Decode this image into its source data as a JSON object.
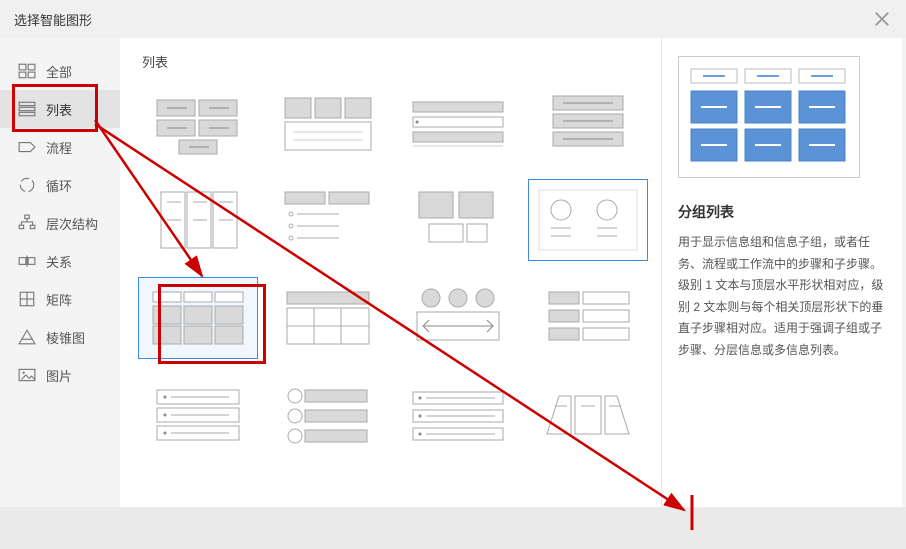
{
  "dialog": {
    "title": "选择智能图形"
  },
  "sidebar": {
    "items": [
      {
        "id": "all",
        "label": "全部"
      },
      {
        "id": "list",
        "label": "列表"
      },
      {
        "id": "process",
        "label": "流程"
      },
      {
        "id": "cycle",
        "label": "循环"
      },
      {
        "id": "hierarchy",
        "label": "层次结构"
      },
      {
        "id": "relationship",
        "label": "关系"
      },
      {
        "id": "matrix",
        "label": "矩阵"
      },
      {
        "id": "pyramid",
        "label": "棱锥图"
      },
      {
        "id": "picture",
        "label": "图片"
      }
    ],
    "active": "list"
  },
  "gallery": {
    "section_title": "列表"
  },
  "preview": {
    "title": "分组列表",
    "description": "用于显示信息组和信息子组，或者任务、流程或工作流中的步骤和子步骤。级别 1 文本与顶层水平形状相对应，级别 2 文本则与每个相关顶层形状下的垂直子步骤相对应。适用于强调子组或子步骤、分层信息或多信息列表。"
  }
}
